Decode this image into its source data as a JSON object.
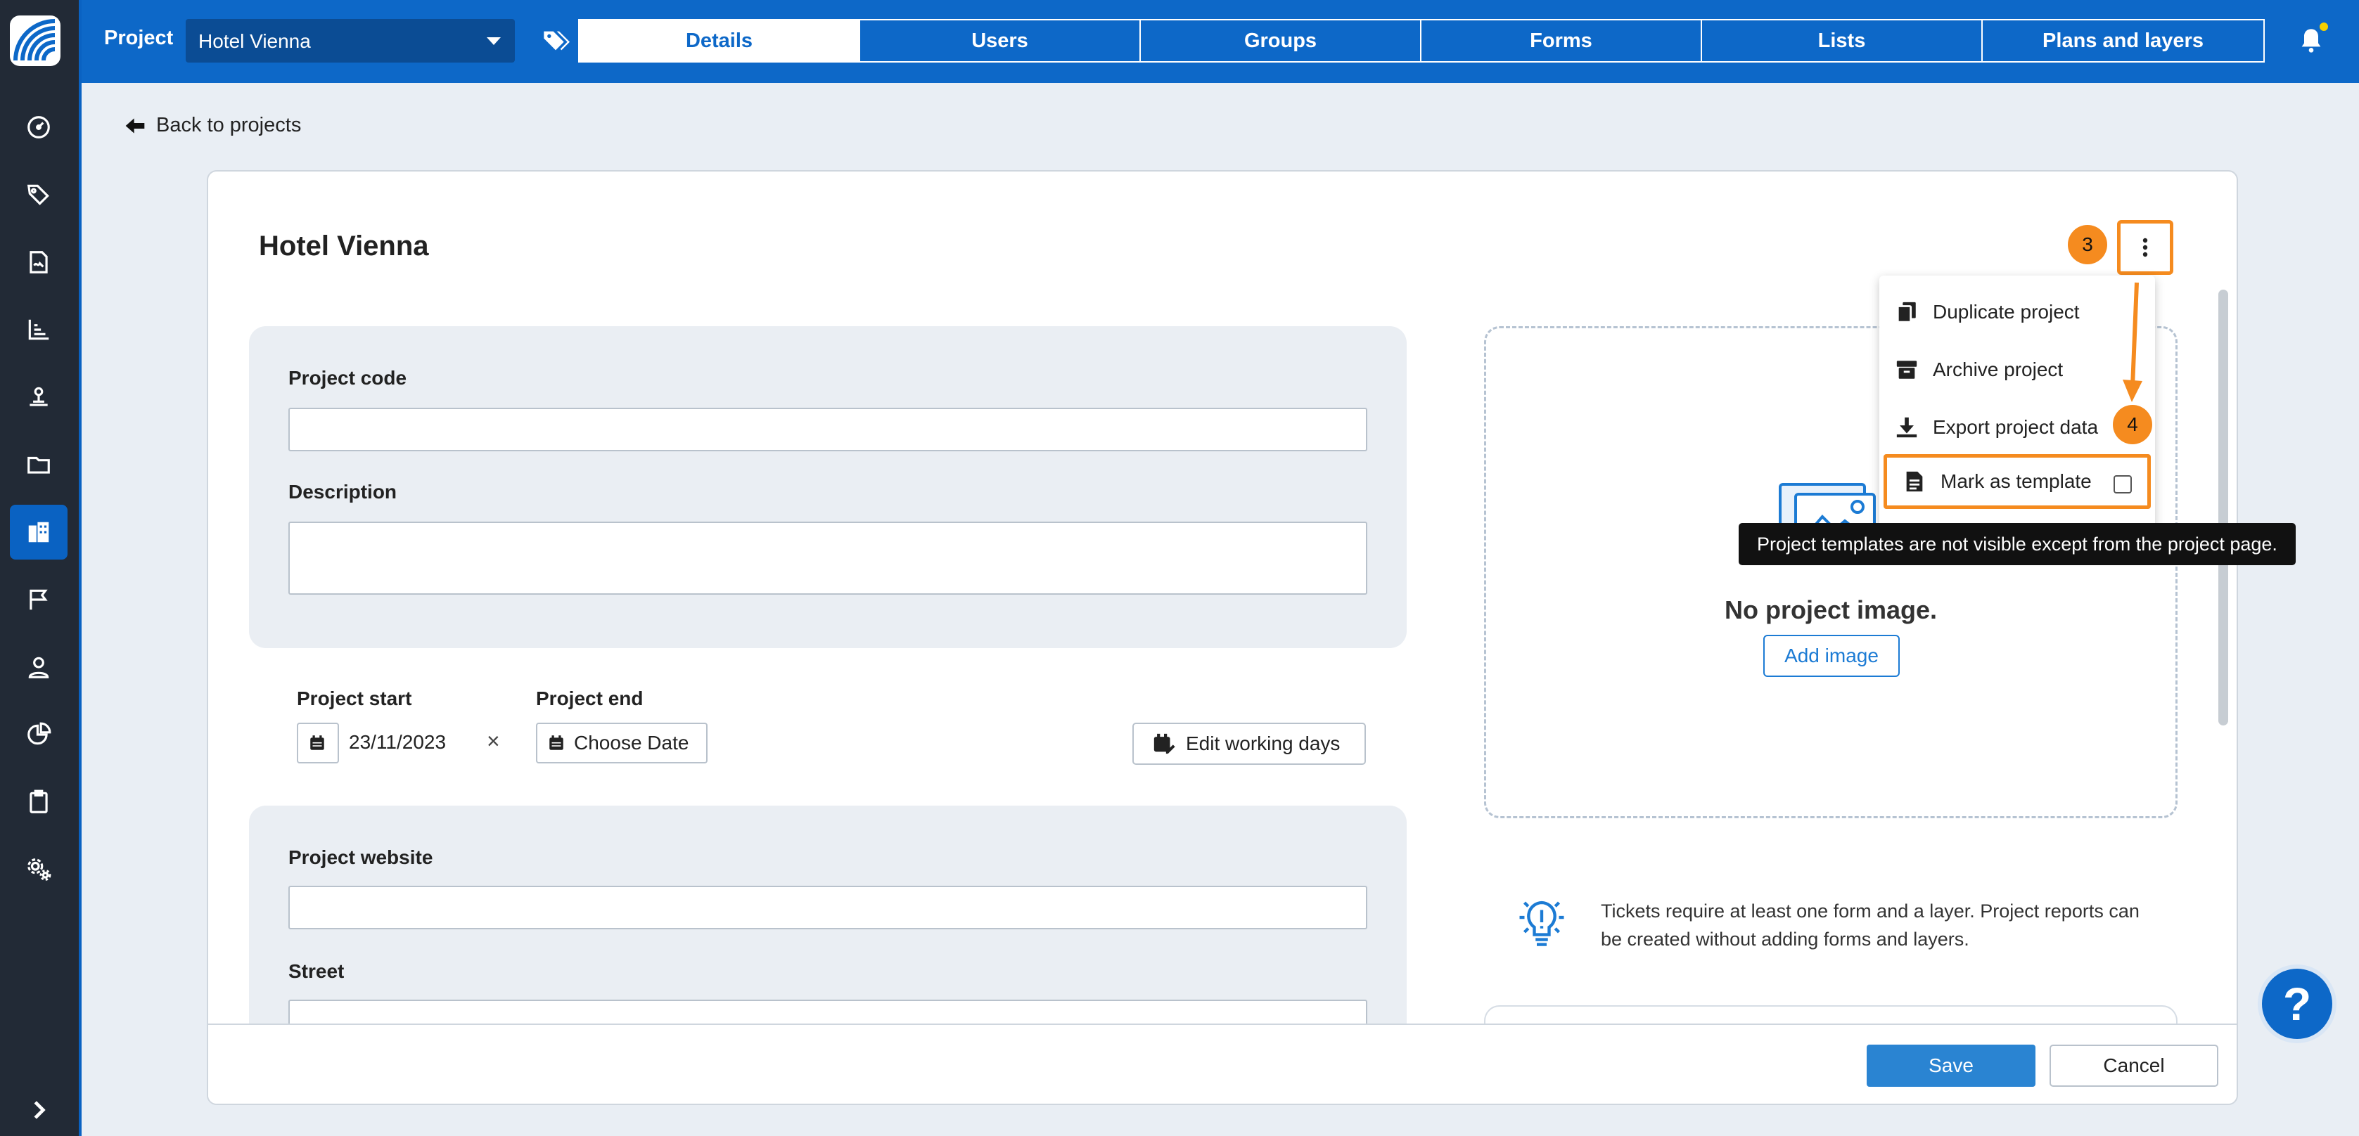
{
  "header": {
    "label": "Project",
    "project_selector_value": "Hotel Vienna",
    "tabs": [
      {
        "label": "Details",
        "active": true
      },
      {
        "label": "Users",
        "active": false
      },
      {
        "label": "Groups",
        "active": false
      },
      {
        "label": "Forms",
        "active": false
      },
      {
        "label": "Lists",
        "active": false
      },
      {
        "label": "Plans and layers",
        "active": false
      }
    ]
  },
  "sidebar": {
    "items": [
      {
        "icon": "dashboard-icon"
      },
      {
        "icon": "tags-icon"
      },
      {
        "icon": "signature-icon"
      },
      {
        "icon": "chart-icon"
      },
      {
        "icon": "location-pin-icon"
      },
      {
        "icon": "folder-icon"
      },
      {
        "icon": "buildings-icon",
        "active": true
      },
      {
        "icon": "flag-icon"
      },
      {
        "icon": "user-icon"
      },
      {
        "icon": "pie-chart-icon"
      },
      {
        "icon": "clipboard-icon"
      },
      {
        "icon": "settings-icon"
      },
      {
        "icon": "chevron-right-icon"
      }
    ]
  },
  "nav": {
    "back_label": "Back to projects"
  },
  "page": {
    "title": "Hotel Vienna"
  },
  "form": {
    "project_code_label": "Project code",
    "project_code_value": "",
    "description_label": "Description",
    "description_value": "",
    "project_start_label": "Project start",
    "project_start_value": "23/11/2023",
    "clear_symbol": "×",
    "project_end_label": "Project end",
    "project_end_value": "Choose Date",
    "edit_working_days_label": "Edit working days",
    "project_website_label": "Project website",
    "project_website_value": "",
    "street_label": "Street",
    "street_value": ""
  },
  "image_panel": {
    "empty_text": "No project image.",
    "add_image_label": "Add image"
  },
  "tip": {
    "text": "Tickets require at least one form and a layer. Project reports can be created without adding forms and layers."
  },
  "menu": {
    "items": [
      {
        "label": "Duplicate project",
        "icon": "copy-icon"
      },
      {
        "label": "Archive project",
        "icon": "archive-icon"
      },
      {
        "label": "Export project data",
        "icon": "download-icon"
      },
      {
        "label": "Mark as template",
        "icon": "file-icon",
        "checked": false
      }
    ]
  },
  "tooltip": {
    "text": "Project templates are not visible except from the project page."
  },
  "annotations": {
    "step_3": "3",
    "step_4": "4",
    "highlight_color": "#f58b1f"
  },
  "footer": {
    "save_label": "Save",
    "cancel_label": "Cancel"
  },
  "help": {
    "label": "?"
  },
  "colors": {
    "brand_blue": "#0d68c8",
    "sidebar_bg": "#222a36",
    "accent_orange": "#f58b1f",
    "notification_dot": "#f5d000"
  }
}
